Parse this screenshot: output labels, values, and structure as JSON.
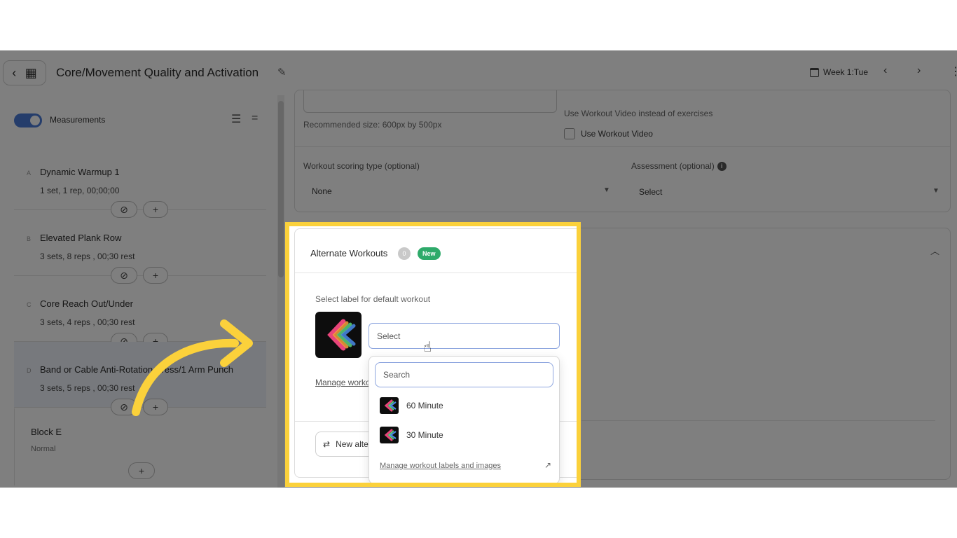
{
  "header": {
    "title": "Core/Movement Quality and Activation",
    "week_label": "Week 1:Tue"
  },
  "sidebar": {
    "toggle_label": "Measurements",
    "exercises": [
      {
        "letter": "A",
        "name": "Dynamic Warmup 1",
        "detail": "1 set, 1 rep, 00;00;00"
      },
      {
        "letter": "B",
        "name": "Elevated Plank Row",
        "detail": "3 sets, 8 reps , 00;30 rest"
      },
      {
        "letter": "C",
        "name": "Core Reach Out/Under",
        "detail": "3 sets, 4 reps , 00;30 rest"
      },
      {
        "letter": "D",
        "name": "Band or Cable Anti-Rotation Press/1 Arm Punch",
        "detail": "3 sets, 5 reps , 00;30 rest"
      }
    ],
    "block": {
      "name": "Block E",
      "type": "Normal"
    }
  },
  "settings": {
    "recommended_size": "Recommended size: 600px by 500px",
    "video_label": "Use Workout Video instead of exercises",
    "video_checkbox": "Use Workout Video",
    "scoring_label": "Workout scoring type (optional)",
    "scoring_value": "None",
    "assessment_label": "Assessment (optional)",
    "assessment_value": "Select"
  },
  "alternate": {
    "title": "Alternate Workouts",
    "count": "0",
    "badge": "New",
    "default_label": "Select label for default workout",
    "select_placeholder": "Select",
    "manage_link_partial": "Manage workout labels and images",
    "new_alt_button": "New alternate workout",
    "dropdown": {
      "search_placeholder": "Search",
      "options": [
        "60 Minute",
        "30 Minute"
      ],
      "manage_link": "Manage workout labels and images"
    }
  },
  "colors": {
    "highlight": "#fbd13b",
    "accent": "#4a7bd6",
    "new_badge": "#2eaa6a"
  }
}
